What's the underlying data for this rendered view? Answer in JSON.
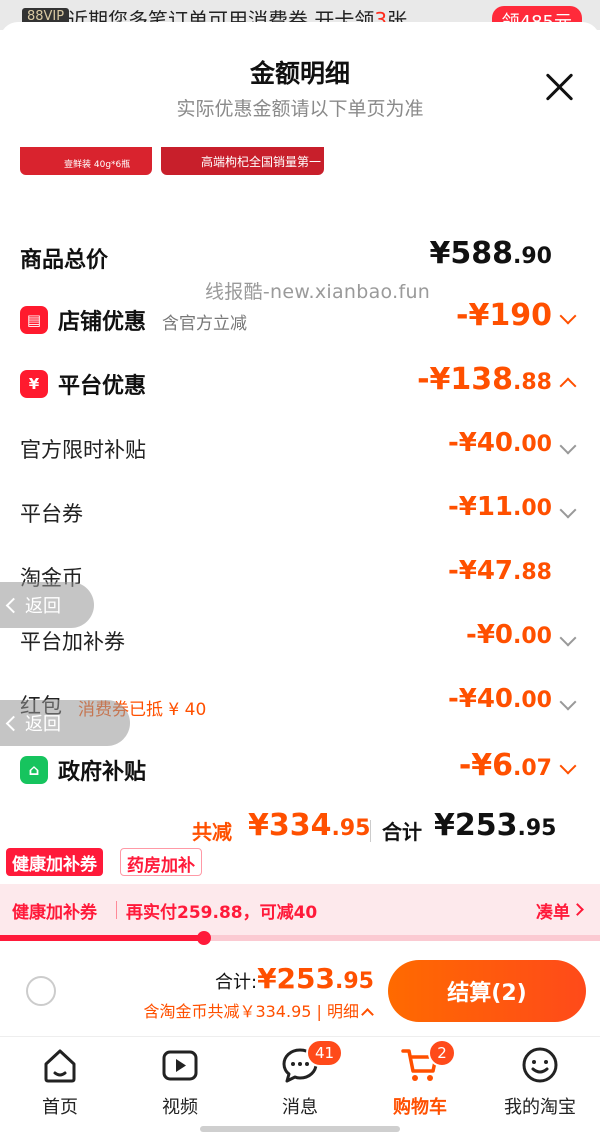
{
  "banner": {
    "badge": "88VIP",
    "text_prefix": "近期您多笔订单可用消费券 开卡领",
    "text_highlight": "3",
    "text_suffix": "张",
    "button": "领485元"
  },
  "sheet": {
    "title": "金额明细",
    "subtitle": "实际优惠金额请以下单页为准",
    "close_icon": "close-icon"
  },
  "thumbs": [
    {
      "caption": "壹鲜装 40g*6瓶"
    },
    {
      "caption": "高端枸杞全国销量第一"
    }
  ],
  "watermark": "线报酷-new.xianbao.fun",
  "lines": {
    "total": {
      "label": "商品总价",
      "amount_int": "¥588",
      "amount_dec": ".90"
    },
    "store": {
      "label": "店铺优惠",
      "note": "含官方立减",
      "amount_int": "-¥190",
      "amount_dec": ""
    },
    "platform": {
      "label": "平台优惠",
      "amount_int": "-¥138",
      "amount_dec": ".88"
    },
    "official": {
      "label": "官方限时补贴",
      "amount_int": "-¥40",
      "amount_dec": ".00"
    },
    "coupon": {
      "label": "平台券",
      "amount_int": "-¥11",
      "amount_dec": ".00"
    },
    "coins": {
      "label": "淘金币",
      "amount_int": "-¥47",
      "amount_dec": ".88"
    },
    "extra": {
      "label": "平台加补券",
      "amount_int": "-¥0",
      "amount_dec": ".00"
    },
    "redpacket": {
      "label": "红包",
      "note": "消费券已抵 ¥ 40",
      "amount_int": "-¥40",
      "amount_dec": ".00"
    },
    "gov": {
      "label": "政府补贴",
      "amount_int": "-¥6",
      "amount_dec": ".07"
    }
  },
  "back_label": "返回",
  "summary": {
    "reduce_label": "共减",
    "reduce_int": "¥334",
    "reduce_dec": ".95",
    "total_label": "合计",
    "total_int": "¥253",
    "total_dec": ".95"
  },
  "tags": [
    "健康加补券",
    "药房加补"
  ],
  "promo": {
    "label": "健康加补券",
    "text": "再实付259.88，可减40",
    "action": "凑单",
    "progress": 0.34
  },
  "checkout": {
    "total_label": "合计:",
    "total_int": "¥253",
    "total_dec": ".95",
    "sub": "含淘金币共减￥334.95 | 明细",
    "button": "结算(2)"
  },
  "tabs": [
    {
      "label": "首页",
      "icon": "home-icon"
    },
    {
      "label": "视频",
      "icon": "video-icon"
    },
    {
      "label": "消息",
      "icon": "message-icon",
      "badge": "41"
    },
    {
      "label": "购物车",
      "icon": "cart-icon",
      "badge": "2",
      "active": true
    },
    {
      "label": "我的淘宝",
      "icon": "profile-icon"
    }
  ],
  "colors": {
    "accent": "#ff5000",
    "red": "#ff1a3a",
    "green": "#16c45e"
  }
}
